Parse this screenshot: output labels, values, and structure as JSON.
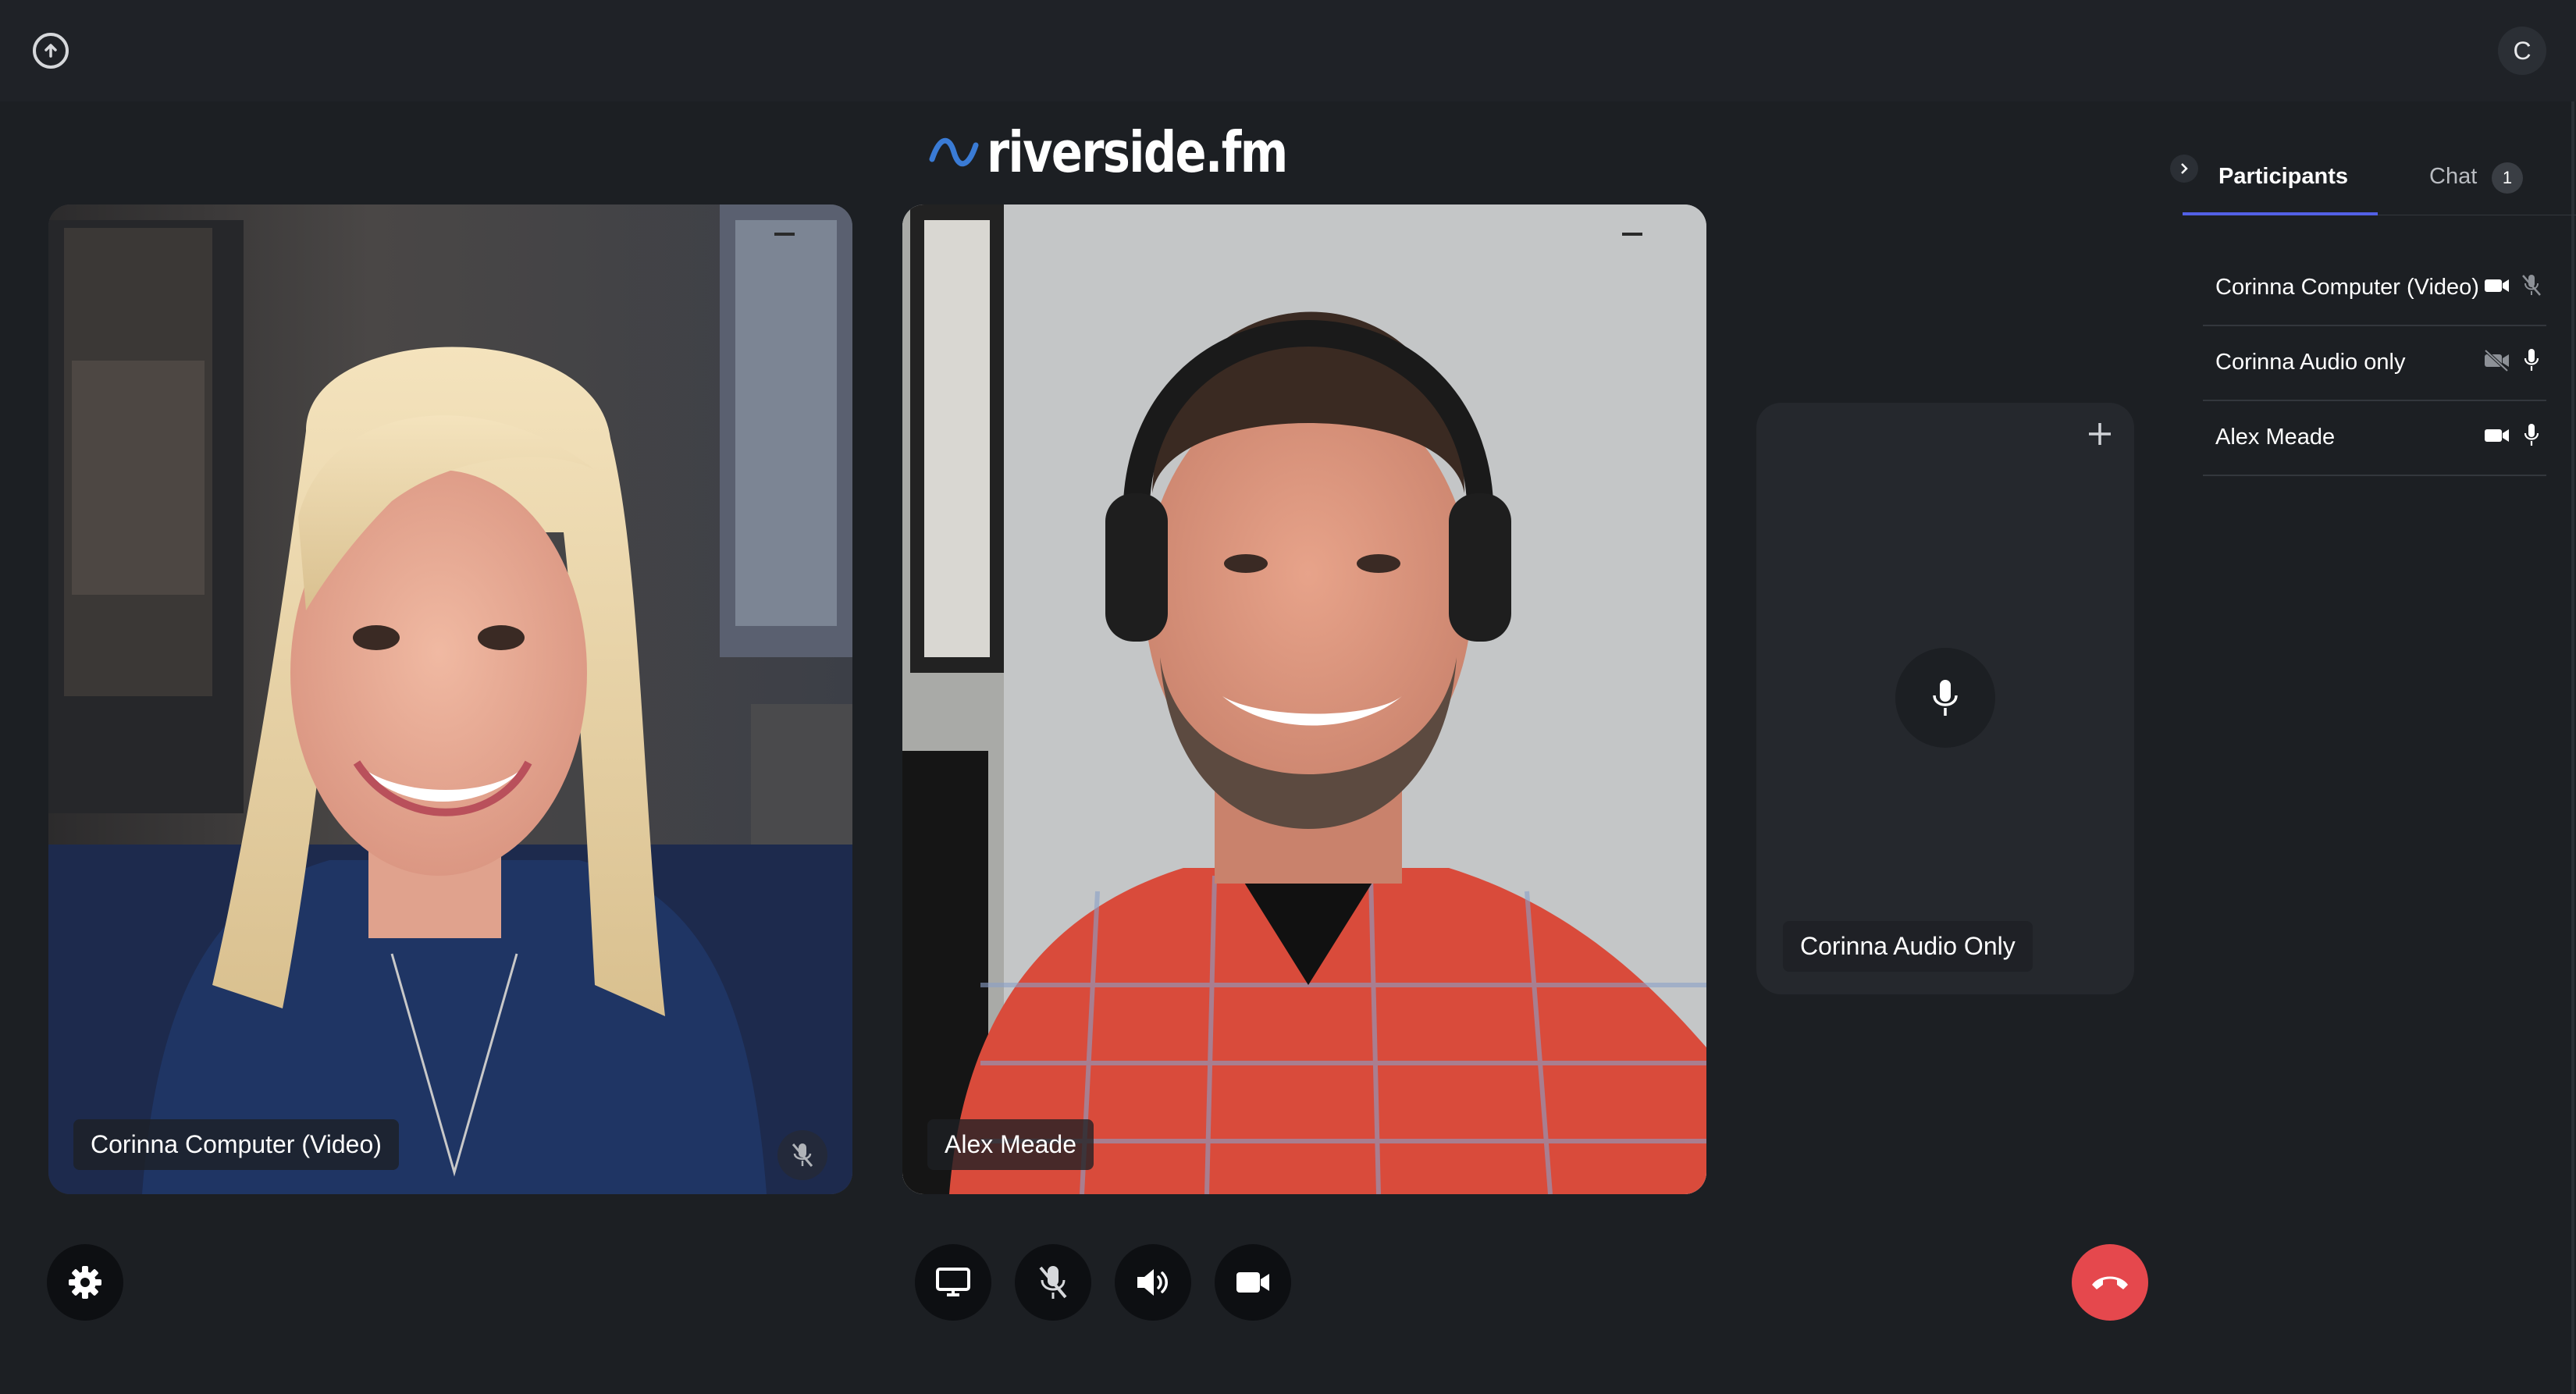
{
  "app": {
    "logo_text": "riverside.fm",
    "user_initial": "C",
    "accent_color": "#5260e6",
    "end_call_color": "#e5484d"
  },
  "topbar": {
    "left_icon": "upload-circle-icon",
    "right_avatar": "C"
  },
  "stage": {
    "tiles": [
      {
        "name": "Corinna Computer (Video)",
        "kind": "video",
        "muted": true
      },
      {
        "name": "Alex Meade",
        "kind": "video",
        "muted": false
      },
      {
        "name": "Corinna Audio Only",
        "kind": "audio",
        "muted": false
      }
    ]
  },
  "controls": {
    "settings_icon": "gear-icon",
    "center": [
      "screen-share-icon",
      "mic-muted-icon",
      "speaker-icon",
      "camera-icon"
    ],
    "end_call_icon": "phone-hangup-icon"
  },
  "panel": {
    "tabs": [
      {
        "label": "Participants",
        "active": true
      },
      {
        "label": "Chat",
        "active": false,
        "badge": "1"
      }
    ],
    "participants": [
      {
        "name": "Corinna Computer (Video)",
        "video": "on",
        "audio": "muted"
      },
      {
        "name": "Corinna Audio only",
        "video": "off",
        "audio": "on"
      },
      {
        "name": "Alex Meade",
        "video": "on",
        "audio": "on"
      }
    ]
  }
}
